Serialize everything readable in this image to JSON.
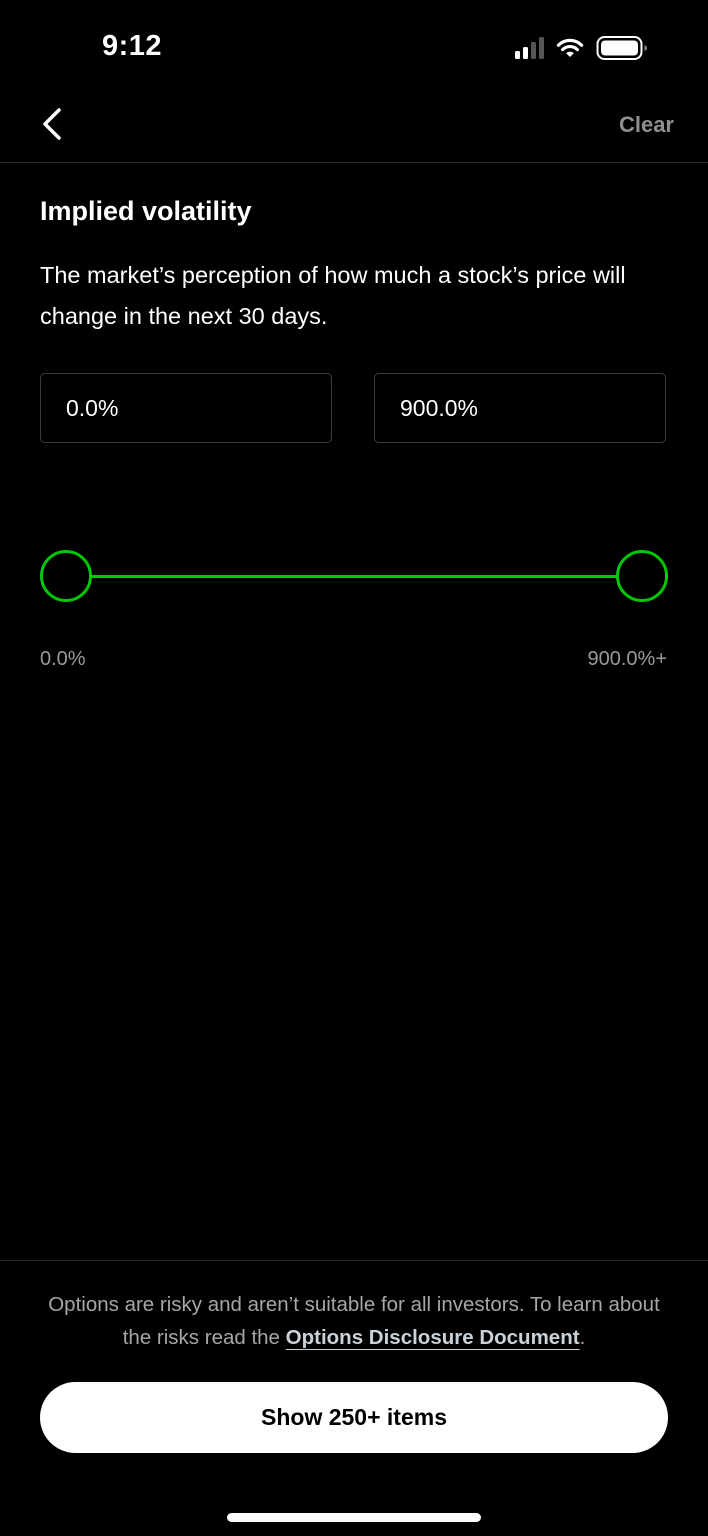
{
  "status_bar": {
    "time": "9:12",
    "icons": [
      "cellular-signal-icon",
      "wifi-icon",
      "battery-icon"
    ]
  },
  "header": {
    "back_icon": "chevron-left-icon",
    "clear_label": "Clear"
  },
  "filter": {
    "title": "Implied volatility",
    "description": "The market’s perception of how much a stock’s price will change in the next 30 days.",
    "min_value": "0.0%",
    "max_value": "900.0%"
  },
  "slider": {
    "min_label": "0.0%",
    "max_label": "900.0%+",
    "selected_min_fraction": 0,
    "selected_max_fraction": 1,
    "accent_color": "#00c805"
  },
  "footer": {
    "disclaimer_before_link": "Options are risky and aren’t suitable for all investors. To learn about the risks read the ",
    "disclaimer_link": "Options Disclosure Document",
    "disclaimer_after_link": ".",
    "show_button_label": "Show 250+ items"
  },
  "colors": {
    "background": "#000000",
    "accent": "#00c805",
    "muted_text": "#9a9a9a",
    "button_background": "#ffffff"
  }
}
